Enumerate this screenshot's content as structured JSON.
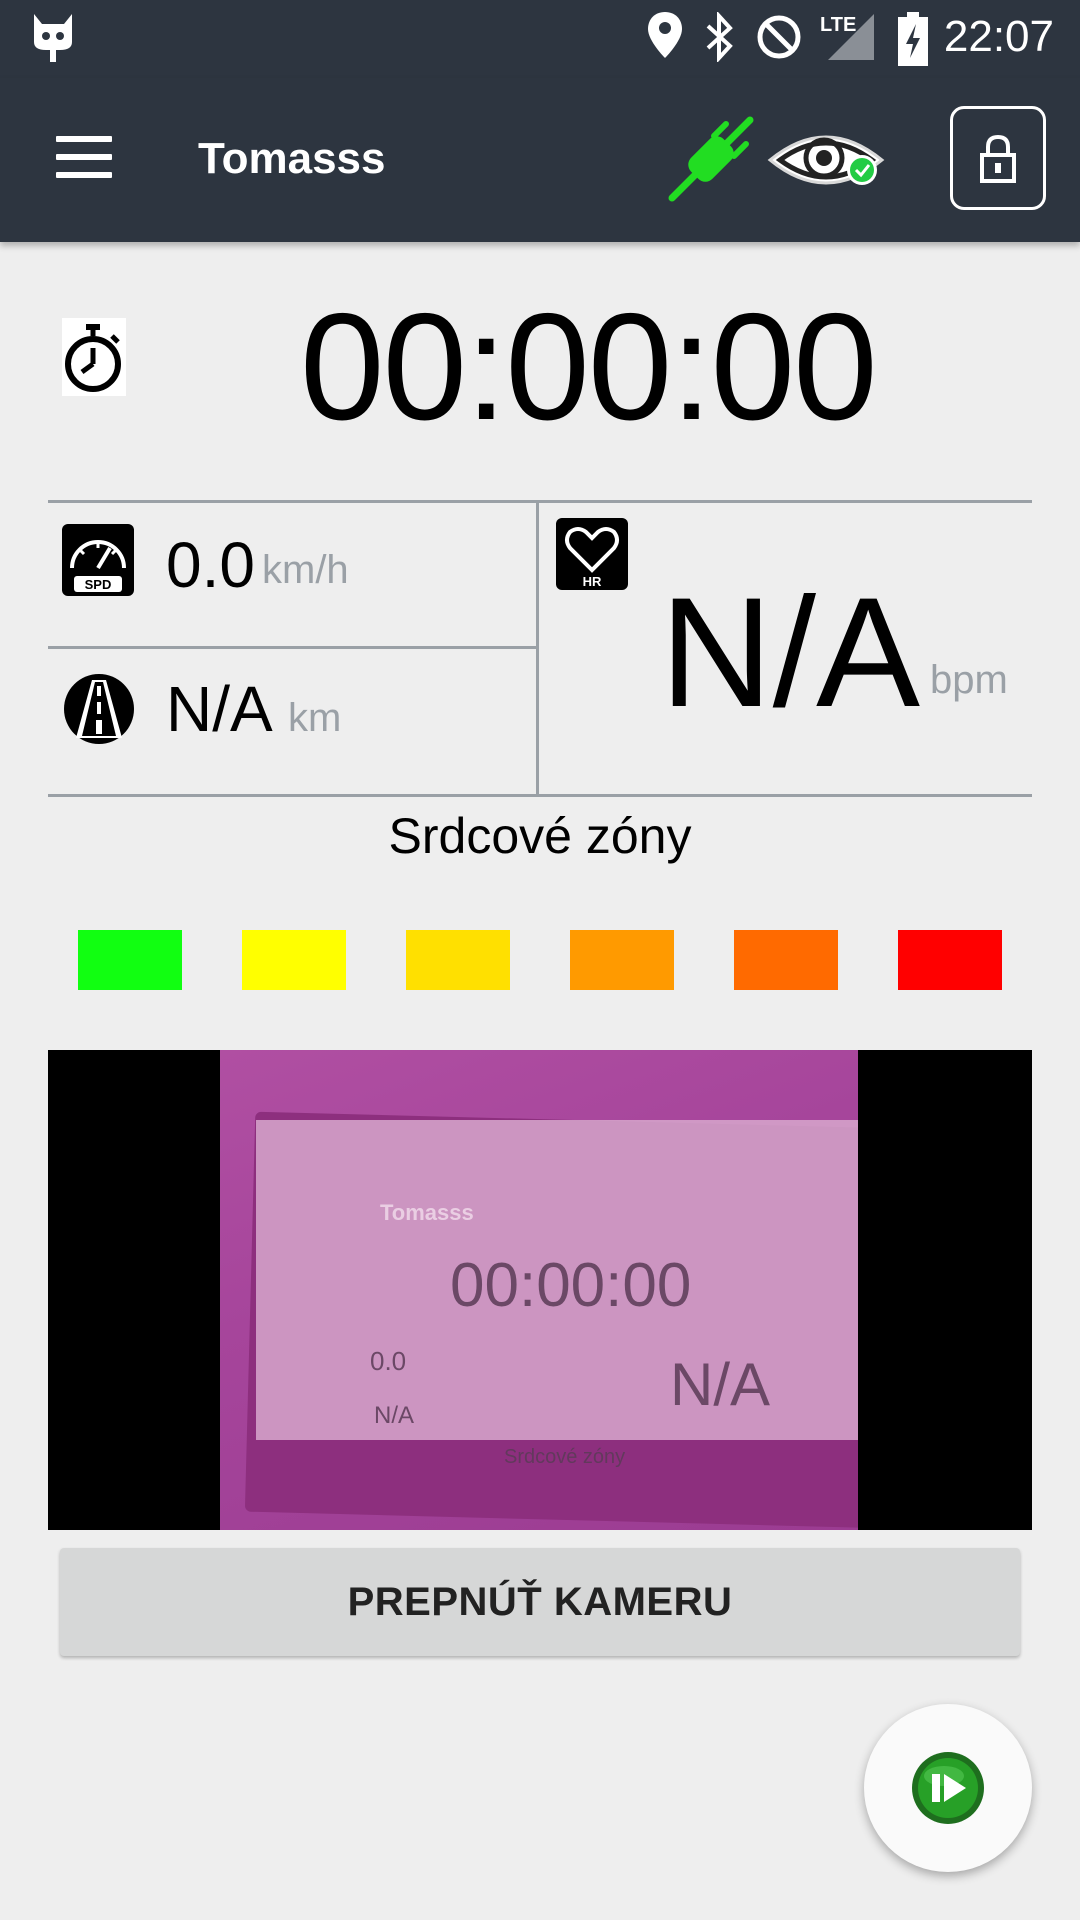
{
  "status_bar": {
    "time": "22:07",
    "network": "LTE",
    "icons": [
      "cyanogenmod-icon",
      "location-icon",
      "bluetooth-icon",
      "do-not-disturb-icon",
      "signal-icon",
      "battery-icon"
    ]
  },
  "app_bar": {
    "title": "Tomasss",
    "icons": [
      "menu-icon",
      "connected-plug-icon",
      "eye-check-icon",
      "lock-icon"
    ]
  },
  "timer": {
    "value": "00:00:00"
  },
  "metrics": {
    "speed": {
      "value": "0.0",
      "unit": "km/h",
      "icon_label": "SPD"
    },
    "distance": {
      "value": "N/A",
      "unit": "km"
    },
    "heart_rate": {
      "value": "N/A",
      "unit": "bpm",
      "icon_label": "HR"
    }
  },
  "zones": {
    "title": "Srdcové zóny",
    "colors": [
      "#11ff11",
      "#ffff00",
      "#ffe000",
      "#ff9a00",
      "#ff6a00",
      "#ff0000"
    ]
  },
  "camera_preview": {
    "title": "Tomasss",
    "timer": "00:00:00",
    "speed": "0.0",
    "distance": "N/A",
    "heart_rate": "N/A",
    "zones_title": "Srdcové zóny"
  },
  "switch_camera_button": {
    "label": "PREPNÚŤ KAMERU"
  },
  "accent_color": "#00cc00"
}
